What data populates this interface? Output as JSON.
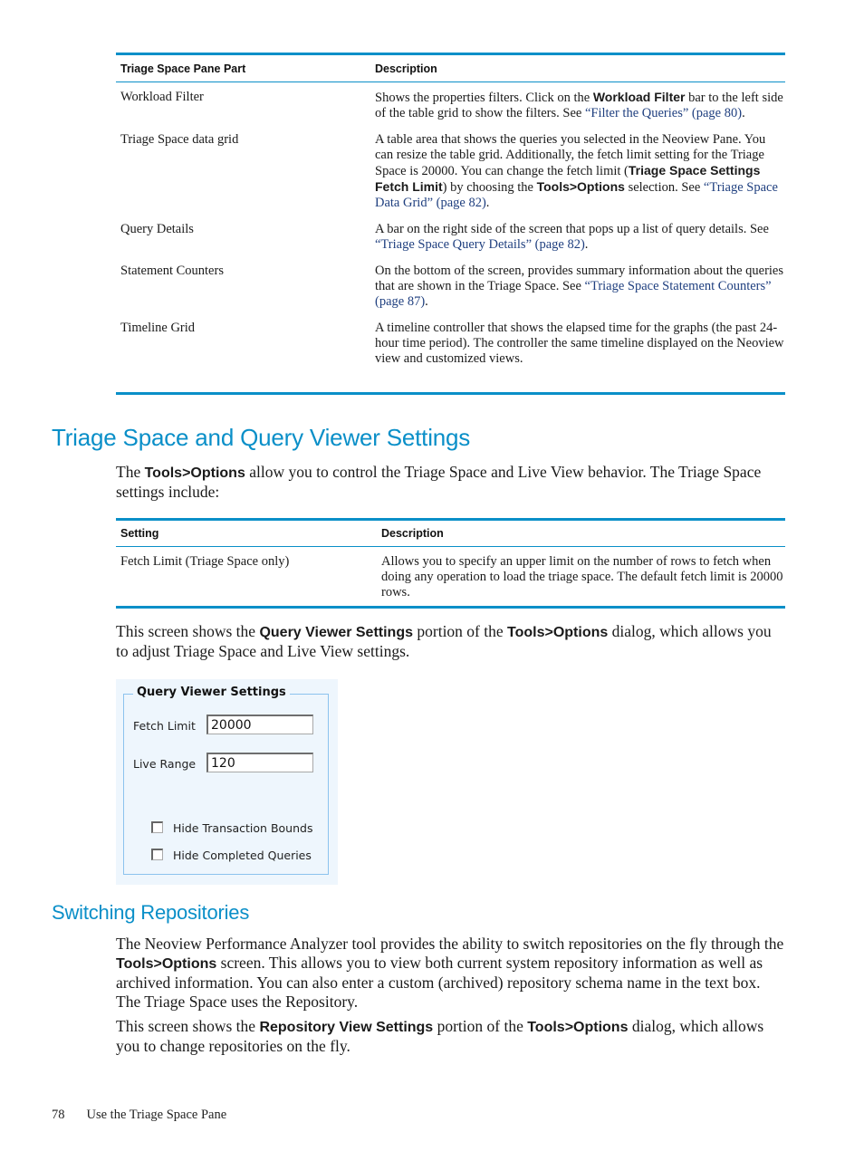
{
  "table1": {
    "headers": [
      "Triage Space Pane Part",
      "Description"
    ],
    "rows": [
      {
        "part": "Workload Filter",
        "desc_1": "Shows the properties filters. Click on the ",
        "desc_bold_1": "Workload Filter",
        "desc_2": " bar to the left side of the table grid to show the filters. See ",
        "link": "“Filter the Queries” (page 80)",
        "desc_3": "."
      },
      {
        "part": "Triage Space data grid",
        "desc_1": "A table area that shows the queries you selected in the Neoview Pane. You can resize the table grid. Additionally, the fetch limit setting for the Triage Space is 20000. You can change the fetch limit (",
        "desc_bold_1": "Triage Space Settings Fetch Limit",
        "desc_2": ") by choosing the ",
        "desc_bold_2": "Tools>Options",
        "desc_3": " selection. See ",
        "link": "“Triage Space Data Grid” (page 82)",
        "desc_4": "."
      },
      {
        "part": "Query Details",
        "desc_1": "A bar on the right side of the screen that pops up a list of query details. See ",
        "link": "“Triage Space Query Details” (page 82)",
        "desc_2": "."
      },
      {
        "part": "Statement Counters",
        "desc_1": "On the bottom of the screen, provides summary information about the queries that are shown in the Triage Space. See ",
        "link": "“Triage Space Statement Counters” (page 87)",
        "desc_2": "."
      },
      {
        "part": "Timeline Grid",
        "desc_1": "A timeline controller that shows the elapsed time for the graphs (the past 24-hour time period). The controller the same timeline displayed on the Neoview view and customized views."
      }
    ]
  },
  "section1": {
    "heading": "Triage Space and Query Viewer Settings",
    "intro_1": "The ",
    "intro_bold": "Tools>Options",
    "intro_2": " allow you to control the Triage Space and Live View behavior. The Triage Space settings include:"
  },
  "table2": {
    "headers": [
      "Setting",
      "Description"
    ],
    "rows": [
      {
        "setting": "Fetch Limit (Triage Space only)",
        "desc": "Allows you to specify an upper limit on the number of rows to fetch when doing any operation to load the triage space. The default fetch limit is 20000 rows."
      }
    ]
  },
  "para_qv": {
    "t1": "This screen shows the ",
    "b1": "Query Viewer Settings",
    "t2": " portion of the ",
    "b2": "Tools>Options",
    "t3": " dialog, which allows you to adjust Triage Space and Live View settings."
  },
  "dialog": {
    "group_title": "Query Viewer Settings",
    "fetch_limit_label": "Fetch Limit",
    "fetch_limit_value": "20000",
    "live_range_label": "Live Range",
    "live_range_value": "120",
    "hide_transaction_bounds_label": "Hide Transaction Bounds",
    "hide_transaction_bounds_checked": false,
    "hide_completed_queries_label": "Hide Completed Queries",
    "hide_completed_queries_checked": false
  },
  "section2": {
    "heading": "Switching Repositories",
    "p1_1": "The Neoview Performance Analyzer tool  provides the ability to switch repositories on the fly through the ",
    "p1_bold": "Tools>Options",
    "p1_2": " screen. This allows you to view both current system repository information as well as archived information. You can also enter a custom (archived) repository schema name in the text box. The Triage Space uses the Repository.",
    "p2_1": "This screen shows the ",
    "p2_b1": "Repository View Settings",
    "p2_2": " portion of the ",
    "p2_b2": "Tools>Options",
    "p2_3": " dialog, which allows you to change repositories on the fly."
  },
  "footer": {
    "page_number": "78",
    "chapter": "Use the Triage Space Pane"
  },
  "colors": {
    "accent": "#0a8fc8",
    "link": "#1f3f7f"
  }
}
